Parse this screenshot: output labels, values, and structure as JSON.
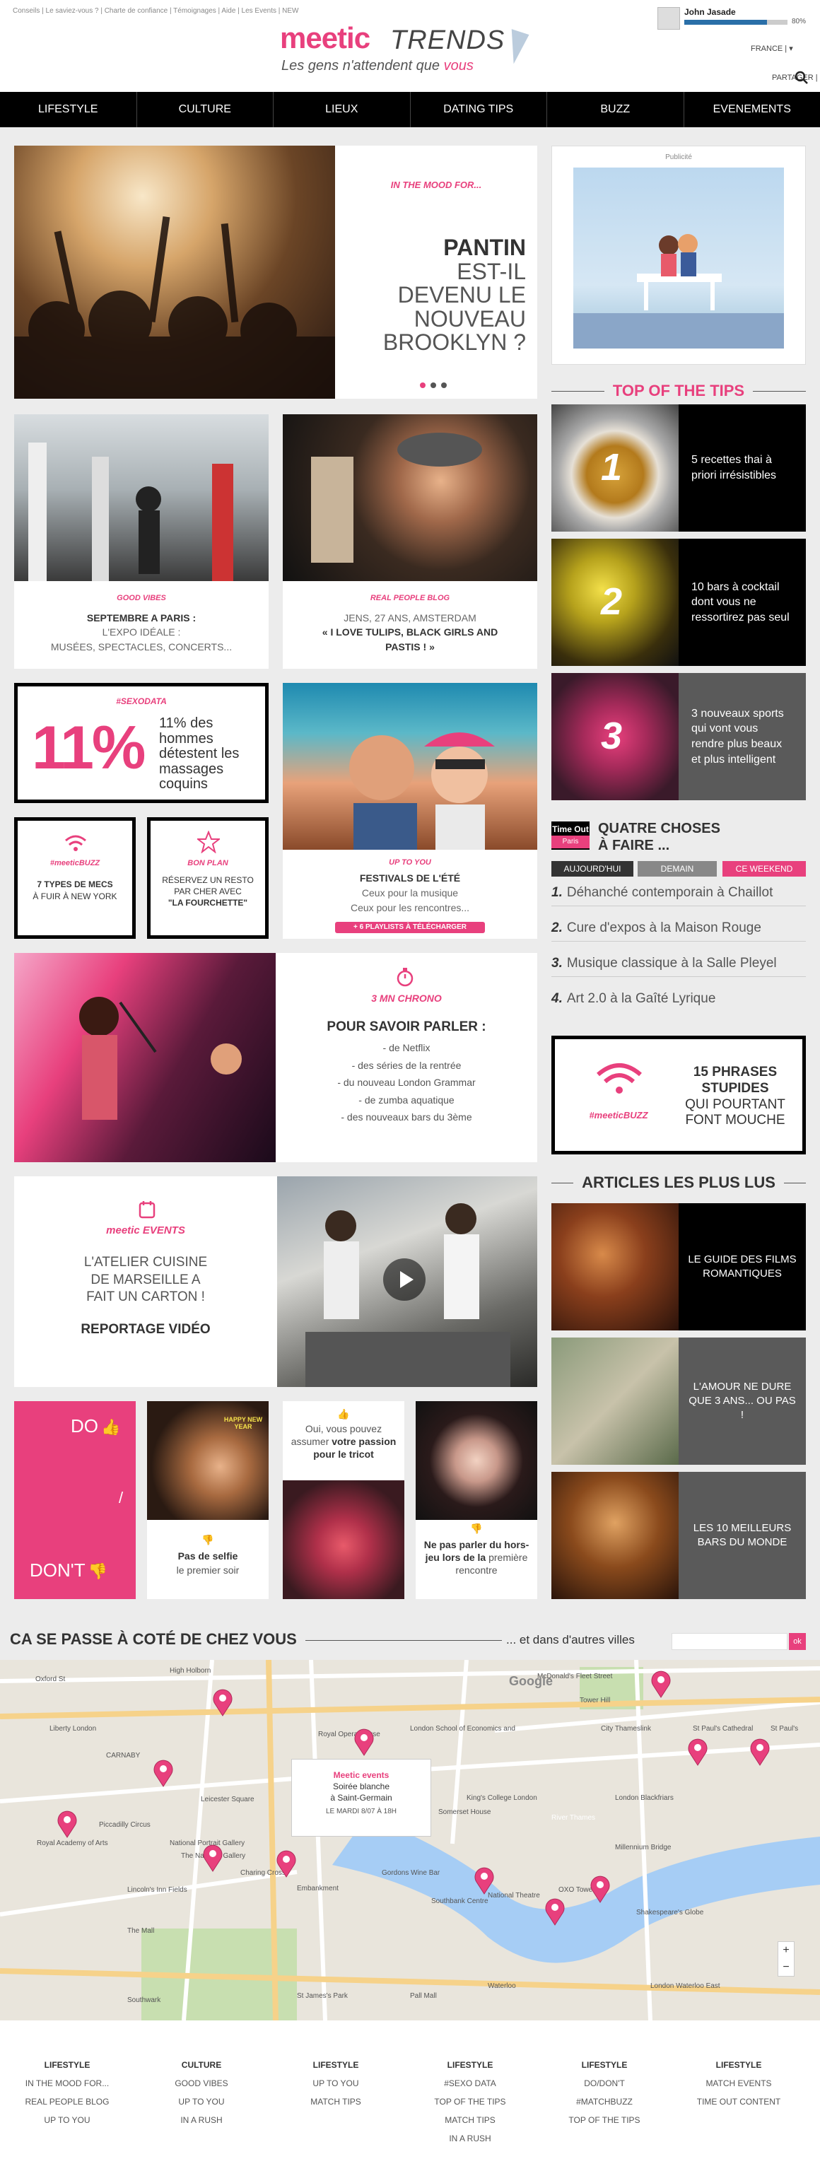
{
  "header": {
    "top_links": "Conseils | Le saviez-vous ? | Charte de confiance | Témoignages | Aide | Les Events | NEW",
    "brand": "meetic",
    "brand_suffix": "TRENDS",
    "tagline_main": "Les gens n'attendent que",
    "tagline_accent": "vous",
    "user_name": "John Jasade",
    "profile_progress": "80%",
    "profile_progress_value": 0.8,
    "country": "FRANCE |",
    "share": "PARTAGER |"
  },
  "nav": [
    "LIFESTYLE",
    "CULTURE",
    "LIEUX",
    "DATING TIPS",
    "BUZZ",
    "EVENEMENTS"
  ],
  "hero": {
    "kicker": "IN THE MOOD FOR...",
    "title_bold": "PANTIN",
    "title_rest": "EST-IL DEVENU LE NOUVEAU BROOKLYN ?"
  },
  "ad_label": "Publicité",
  "cards": {
    "good_vibes": {
      "tag": "GOOD VIBES",
      "title": "SEPTEMBRE A PARIS :",
      "sub1": "L'EXPO IDÉALE :",
      "sub2": "MUSÉES, SPECTACLES, CONCERTS..."
    },
    "people_blog": {
      "tag": "REAL PEOPLE BLOG",
      "line1": "JENS, 27 ANS, AMSTERDAM",
      "line2": "« I LOVE TULIPS, BLACK GIRLS AND PASTIS ! »"
    },
    "sexodata": {
      "tag": "#SEXODATA",
      "big": "11%",
      "text": "11% des hommes détestent les massages coquins"
    },
    "buzz_small": {
      "tag": "#meeticBUZZ",
      "title": "7 TYPES DE MECS",
      "sub": "À FUIR À NEW YORK"
    },
    "bon_plan": {
      "tag": "BON PLAN",
      "line1": "RÉSERVEZ UN RESTO PAR CHER AVEC",
      "line2": "\"LA FOURCHETTE\""
    },
    "up_to_you": {
      "tag": "UP TO YOU",
      "title": "FESTIVALS DE L'ÉTÉ",
      "sub1": "Ceux pour la musique",
      "sub2": "Ceux pour les rencontres...",
      "badge": "6 PLAYLISTS À TÉLÉCHARGER"
    },
    "chrono": {
      "tag": "3 MN CHRONO",
      "title": "POUR SAVOIR PARLER :",
      "items": [
        "- de Netflix",
        "- des séries de la rentrée",
        "- du nouveau London Grammar",
        "- de zumba aquatique",
        "- des nouveaux bars du 3ème"
      ]
    },
    "events": {
      "tag": "meetic EVENTS",
      "line1": "L'ATELIER CUISINE DE MARSEILLE A FAIT UN CARTON !",
      "line2": "REPORTAGE VIDÉO"
    },
    "do": {
      "do": "DO",
      "sep": "/",
      "dont": "DON'T"
    },
    "selfie": {
      "title": "Pas de selfie",
      "sub": "le premier soir",
      "overlay": "HAPPY NEW YEAR"
    },
    "tricot": {
      "pre": "Oui, vous pouvez assumer",
      "bold": "votre passion pour le tricot"
    },
    "horsjeu": {
      "bold": "Ne pas parler du hors-jeu lors de la",
      "rest": "première rencontre"
    }
  },
  "top_tips": {
    "title": "TOP OF THE TIPS",
    "items": [
      {
        "num": "1",
        "text": "5 recettes thai à priori irrésistibles"
      },
      {
        "num": "2",
        "text": "10 bars à cocktail dont vous ne ressortirez pas seul"
      },
      {
        "num": "3",
        "text": "3 nouveaux sports qui vont vous rendre plus beaux et plus intelligent"
      }
    ]
  },
  "timeout": {
    "logo_top": "Time Out",
    "logo_city": "Paris",
    "title": "QUATRE CHOSES À FAIRE ...",
    "tabs": [
      "AUJOURD'HUI",
      "DEMAIN",
      "CE WEEKEND"
    ],
    "items": [
      {
        "n": "1.",
        "t": "Déhanché contemporain à Chaillot"
      },
      {
        "n": "2.",
        "t": "Cure d'expos à la Maison Rouge"
      },
      {
        "n": "3.",
        "t": "Musique classique à la Salle Pleyel"
      },
      {
        "n": "4.",
        "t": "Art 2.0 à la Gaîté Lyrique"
      }
    ]
  },
  "buzz_box": {
    "tag": "#meeticBUZZ",
    "l1": "15 PHRASES STUPIDES",
    "l2": "QUI POURTANT FONT MOUCHE"
  },
  "most_read": {
    "title": "ARTICLES LES PLUS LUS",
    "items": [
      "LE GUIDE DES FILMS ROMANTIQUES",
      "L'AMOUR NE DURE QUE 3 ANS... OU PAS !",
      "LES 10 MEILLEURS BARS DU MONDE"
    ]
  },
  "local": {
    "title": "CA SE PASSE À COTÉ DE CHEZ VOUS",
    "other": "... et dans d'autres villes",
    "ok": "ok"
  },
  "map": {
    "popup_title": "Meetic events",
    "popup_l1": "Soirée blanche",
    "popup_l2": "à Saint-Germain",
    "popup_date": "LE MARDI 8/07 À 18H",
    "labels": [
      "Oxford St",
      "High Holborn",
      "Liberty London",
      "CARNABY",
      "Leicester Square",
      "Piccadilly Circus",
      "Royal Academy of Arts",
      "National Portrait Gallery",
      "The National Gallery",
      "Charing Cross",
      "Embankment",
      "Gordons Wine Bar",
      "Royal Opera House",
      "London School of Economics and",
      "King's College London",
      "Somerset House",
      "River Thames",
      "National Theatre",
      "OXO Tower",
      "Southbank Centre",
      "Shakespeare's Globe",
      "Millennium Bridge",
      "London Blackfriars",
      "City Thameslink",
      "St Paul's Cathedral",
      "St Paul's",
      "Tower Hill",
      "McDonald's Fleet Street",
      "Lincoln's Inn Fields",
      "St James's Park",
      "The Mall",
      "Pall Mall",
      "Waterloo",
      "London Waterloo East",
      "Southwark",
      "Google"
    ]
  },
  "footer": [
    {
      "head": "LIFESTYLE",
      "items": [
        "IN THE MOOD FOR...",
        "REAL PEOPLE BLOG",
        "UP TO YOU"
      ]
    },
    {
      "head": "CULTURE",
      "items": [
        "GOOD VIBES",
        "UP TO YOU",
        "IN A RUSH"
      ]
    },
    {
      "head": "LIFESTYLE",
      "items": [
        "UP TO YOU",
        "MATCH TIPS"
      ]
    },
    {
      "head": "LIFESTYLE",
      "items": [
        "#SEXO DATA",
        "TOP OF THE TIPS",
        "MATCH TIPS",
        "IN A RUSH"
      ]
    },
    {
      "head": "LIFESTYLE",
      "items": [
        "DO/DON'T",
        "#MATCHBUZZ",
        "TOP OF THE TIPS"
      ]
    },
    {
      "head": "LIFESTYLE",
      "items": [
        "MATCH EVENTS",
        "TIME OUT CONTENT"
      ]
    }
  ],
  "colors": {
    "accent": "#e8407d",
    "black": "#000000",
    "grey": "#5a5a5a",
    "bg": "#ececec"
  }
}
